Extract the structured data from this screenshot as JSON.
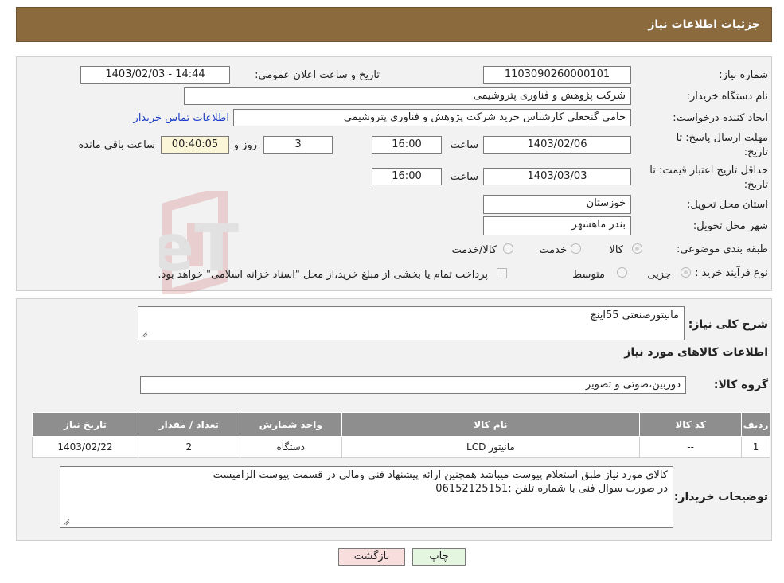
{
  "header": {
    "title": "جزئیات اطلاعات نیاز"
  },
  "details": {
    "need_number_label": "شماره نیاز:",
    "need_number": "1103090260000101",
    "announce_label": "تاریخ و ساعت اعلان عمومی:",
    "announce_value": "1403/02/03 - 14:44",
    "buyer_org_label": "نام دستگاه خریدار:",
    "buyer_org": "شرکت پژوهش و فناوری پتروشیمی",
    "creator_label": "ایجاد کننده درخواست:",
    "creator": "حامی گنجعلی کارشناس خرید شرکت پژوهش و فناوری پتروشیمی",
    "contact_link": "اطلاعات تماس خریدار",
    "deadline_label_1": "مهلت ارسال پاسخ: تا",
    "deadline_label_2": "تاریخ:",
    "deadline_date": "1403/02/06",
    "hour_label": "ساعت",
    "deadline_time": "16:00",
    "days": "3",
    "day_and_label": "روز و",
    "remaining": "00:40:05",
    "remaining_label": "ساعت باقی مانده",
    "validity_label_1": "حداقل تاریخ اعتبار قیمت: تا",
    "validity_label_2": "تاریخ:",
    "validity_date": "1403/03/03",
    "validity_hour_label": "ساعت",
    "validity_time": "16:00",
    "province_label": "استان محل تحویل:",
    "province": "خوزستان",
    "city_label": "شهر محل تحویل:",
    "city": "بندر ماهشهر",
    "category_label": "طبقه بندی موضوعی:",
    "category_options": [
      "کالا",
      "خدمت",
      "کالا/خدمت"
    ],
    "process_label": "نوع فرآیند خرید :",
    "process_options": [
      "جزیی",
      "متوسط"
    ],
    "payment_note": "پرداخت تمام یا بخشی از مبلغ خرید،از محل \"اسناد خزانه اسلامی\" خواهد بود."
  },
  "summary": {
    "description_label": "شرح کلی نیاز:",
    "description": "مانیتورصنعتی 55اینچ",
    "goods_title": "اطلاعات کالاهای مورد نیاز",
    "group_label": "گروه کالا:",
    "group": "دوربین،صوتی و تصویر"
  },
  "table": {
    "headers": [
      "ردیف",
      "کد کالا",
      "نام کالا",
      "واحد شمارش",
      "تعداد / مقدار",
      "تاریخ نیاز"
    ],
    "rows": [
      [
        "1",
        "--",
        "مانیتور LCD",
        "دستگاه",
        "2",
        "1403/02/22"
      ]
    ]
  },
  "buyer_notes": {
    "label": "توضیحات خریدار:",
    "line1": "کالای مورد نیاز طبق استعلام پیوست میباشد همچنین ارائه پیشنهاد فنی ومالی در قسمت پیوست الزامیست",
    "line2": "در صورت سوال فنی با شماره تلفن :06152125151"
  },
  "buttons": {
    "print": "چاپ",
    "back": "بازگشت"
  },
  "watermark": "AriaTender.neT",
  "colors": {
    "header": "#8b6a3e",
    "table_header": "#8e8e8e",
    "remaining_bg": "#fbf6d8",
    "back_btn": "#f9dede",
    "print_btn": "#e4f5e0"
  }
}
